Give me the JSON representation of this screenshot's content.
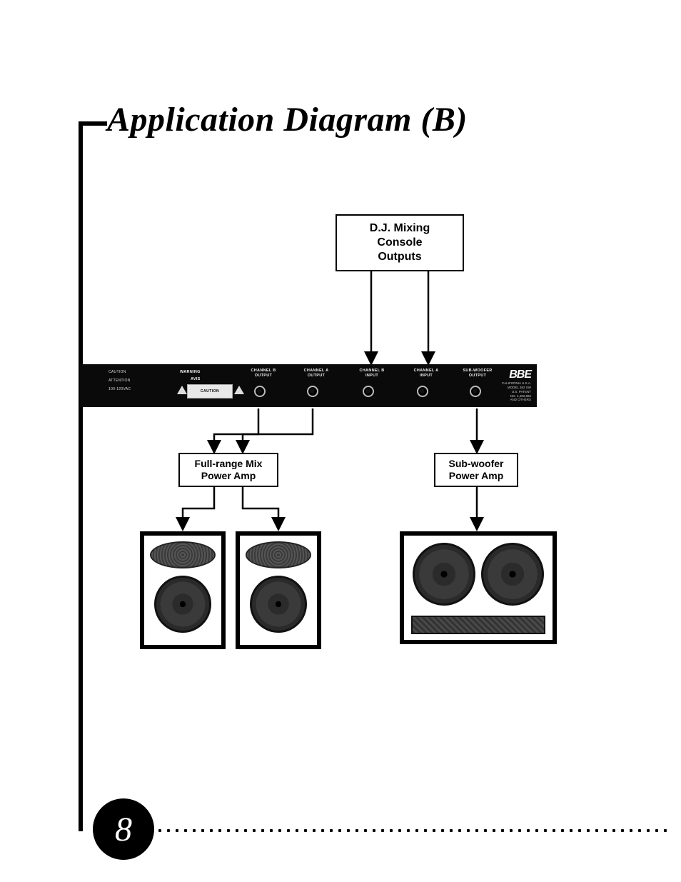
{
  "title": "Application Diagram (B)",
  "page_number": "8",
  "boxes": {
    "mixing": "D.J. Mixing\nConsole\nOutputs",
    "fullrange": "Full-range Mix\nPower Amp",
    "subwoofer": "Sub-woofer\nPower Amp"
  },
  "rack": {
    "brand": "BBE",
    "left_col": "CAUTION\n\nATTENTION\n\n100-120VAC",
    "warning_label": "WARNING",
    "avis_label": "AVIS",
    "caution_plate": "CAUTION",
    "jacks": [
      {
        "label": "CHANNEL B\nOUTPUT"
      },
      {
        "label": "CHANNEL A\nOUTPUT"
      },
      {
        "label": "CHANNEL B\nINPUT"
      },
      {
        "label": "CHANNEL A\nINPUT"
      },
      {
        "label": "SUB-WOOFER\nOUTPUT"
      }
    ],
    "brand_sub": "CALIFORNIA U.S.A.\nMODEL 362 SW\nU.S. PATENT\nNO. 4,482,866\nAND OTHERS"
  }
}
